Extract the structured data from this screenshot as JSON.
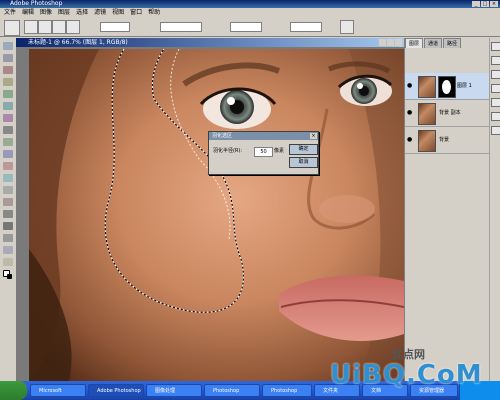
{
  "app": {
    "title": "Adobe Photoshop"
  },
  "menu": [
    "文件",
    "编辑",
    "图像",
    "图层",
    "选择",
    "滤镜",
    "视图",
    "窗口",
    "帮助"
  ],
  "document": {
    "title": "未标题-1 @ 66.7% (图层 1, RGB/8)"
  },
  "dialog": {
    "title": "羽化选区",
    "label": "羽化半径(R):",
    "value": "50",
    "unit": "像素",
    "ok": "确定",
    "cancel": "取消"
  },
  "layers_panel": {
    "tabs": [
      "图层",
      "通道",
      "路径"
    ],
    "layers": [
      {
        "name": "图层 1",
        "selected": true,
        "has_mask": true
      },
      {
        "name": "背景 副本",
        "selected": false,
        "has_mask": false
      },
      {
        "name": "背景",
        "selected": false,
        "has_mask": false
      }
    ]
  },
  "taskbar": {
    "items": [
      "Microsoft",
      "Adobe Photoshop",
      "图像处理",
      "Photoshop",
      "Photoshop",
      "文件夹",
      "文档",
      "资源管理器"
    ]
  },
  "watermark": {
    "text": "UiBQ.CoM",
    "subtext": "优点网"
  },
  "colors": {
    "title_bar": "#0a246a",
    "ui_gray": "#d4d0c8",
    "taskbar": "#245edb",
    "watermark": "#2f8fd0"
  }
}
